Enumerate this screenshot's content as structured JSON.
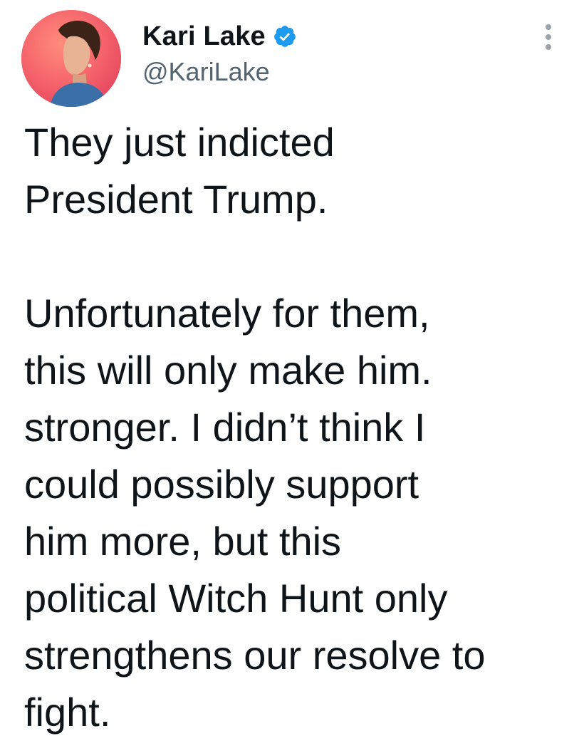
{
  "author": {
    "display_name": "Kari Lake",
    "handle": "@KariLake",
    "verified_icon": "verified-badge-icon",
    "verified_color": "#1d9bf0"
  },
  "menu": {
    "icon": "more-options-icon"
  },
  "tweet": {
    "paragraph_1": [
      "They just indicted",
      "President Trump."
    ],
    "paragraph_2": [
      "Unfortunately for them,",
      "this will only make him.",
      "stronger. I didn’t think I",
      "could possibly support",
      "him more, but this",
      "political Witch Hunt only",
      "strengthens our resolve to",
      "fight."
    ]
  }
}
